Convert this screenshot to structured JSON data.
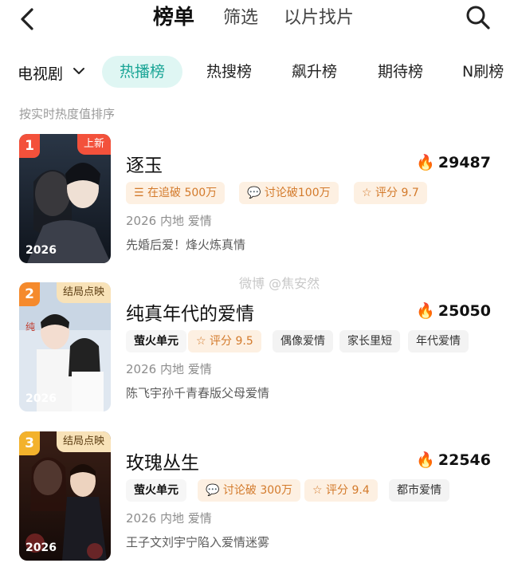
{
  "topbar": {
    "tabs": [
      "榜单",
      "筛选",
      "以片找片"
    ],
    "active_tab": "榜单"
  },
  "category": {
    "selector": "电视剧",
    "pills": [
      "热播榜",
      "热搜榜",
      "飙升榜",
      "期待榜",
      "N刷榜"
    ],
    "active_pill": "热播榜",
    "accent_color": "#1aa596"
  },
  "subtitle": "按实时热度值排序",
  "watermark": "微博 @焦安然",
  "shows": [
    {
      "rank": "1",
      "badge": "上新",
      "poster_year": "2026",
      "title": "逐玉",
      "heat": "29487",
      "chips": [
        "在追破 500万",
        "讨论破100万",
        "评分 9.7"
      ],
      "meta": "2026 内地 爱情",
      "desc": "先婚后爱！烽火炼真情"
    },
    {
      "rank": "2",
      "badge": "结局点映",
      "poster_year": "2026",
      "title": "纯真年代的爱情",
      "heat": "25050",
      "chips": [
        "萤火单元",
        "评分 9.5",
        "偶像爱情",
        "家长里短",
        "年代爱情"
      ],
      "meta": "2026 内地 爱情",
      "desc": "陈飞宇孙千青春版父母爱情"
    },
    {
      "rank": "3",
      "badge": "结局点映",
      "poster_year": "2026",
      "title": "玫瑰丛生",
      "heat": "22546",
      "chips": [
        "萤火单元",
        "讨论破 300万",
        "评分 9.4",
        "都市爱情"
      ],
      "meta": "2026 内地 爱情",
      "desc": "王子文刘宇宁陷入爱情迷雾"
    }
  ]
}
